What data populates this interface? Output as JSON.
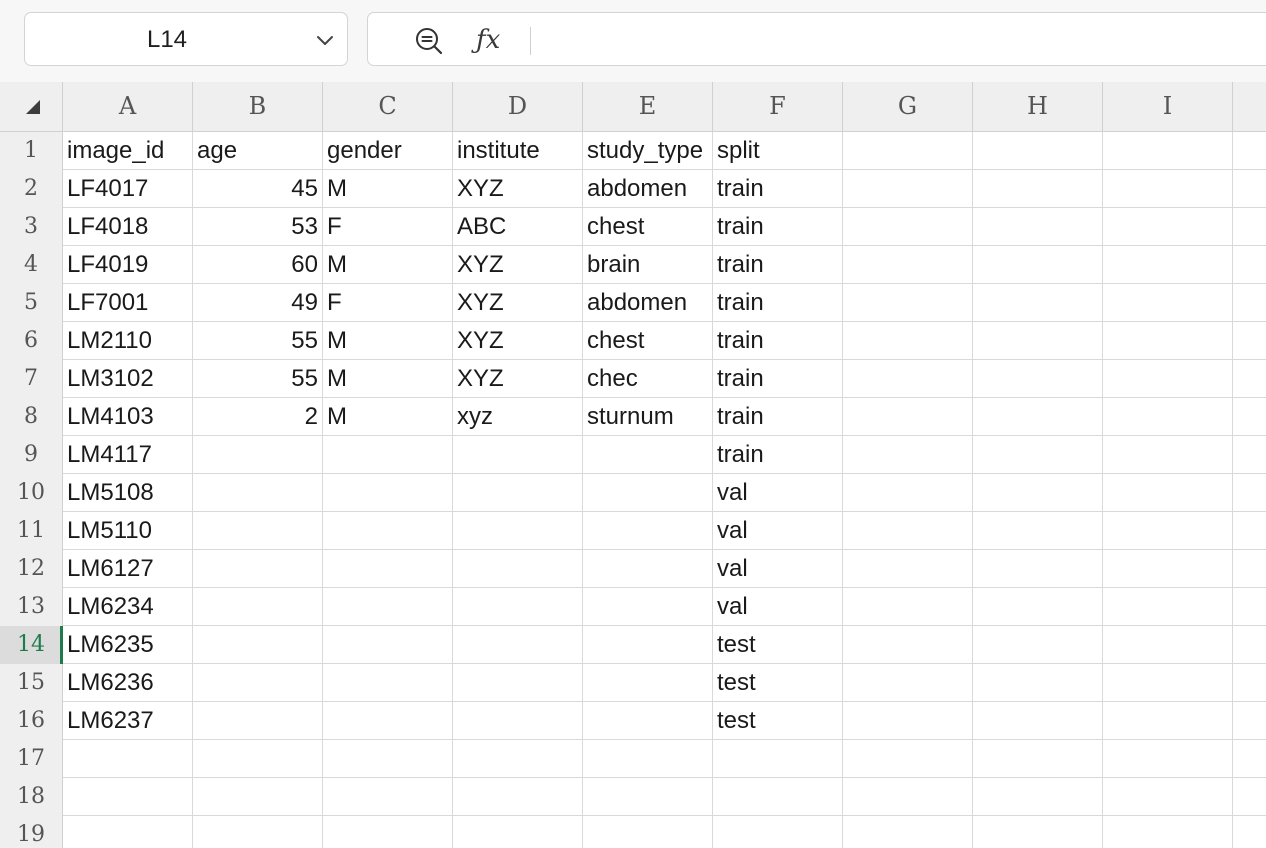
{
  "name_box": {
    "value": "L14"
  },
  "formula_bar": {
    "value": ""
  },
  "sheet": {
    "columns": [
      "A",
      "B",
      "C",
      "D",
      "E",
      "F",
      "G",
      "H",
      "I"
    ],
    "row_numbers": [
      "1",
      "2",
      "3",
      "4",
      "5",
      "6",
      "7",
      "8",
      "9",
      "10",
      "11",
      "12",
      "13",
      "14",
      "15",
      "16",
      "17",
      "18",
      "19"
    ],
    "active_row": "14",
    "rows": [
      [
        "image_id",
        "age",
        "gender",
        "institute",
        "study_type",
        "split"
      ],
      [
        "LF4017",
        "45",
        "M",
        "XYZ",
        "abdomen",
        "train"
      ],
      [
        "LF4018",
        "53",
        "F",
        "ABC",
        "chest",
        "train"
      ],
      [
        "LF4019",
        "60",
        "M",
        "XYZ",
        "brain",
        "train"
      ],
      [
        "LF7001",
        "49",
        "F",
        "XYZ",
        "abdomen",
        "train"
      ],
      [
        "LM2110",
        "55",
        "M",
        "XYZ",
        "chest",
        "train"
      ],
      [
        "LM3102",
        "55",
        "M",
        "XYZ",
        "chec",
        "train"
      ],
      [
        "LM4103",
        "2",
        "M",
        "xyz",
        "sturnum",
        "train"
      ],
      [
        "LM4117",
        "",
        "",
        "",
        "",
        "train"
      ],
      [
        "LM5108",
        "",
        "",
        "",
        "",
        "val"
      ],
      [
        "LM5110",
        "",
        "",
        "",
        "",
        "val"
      ],
      [
        "LM6127",
        "",
        "",
        "",
        "",
        "val"
      ],
      [
        "LM6234",
        "",
        "",
        "",
        "",
        "val"
      ],
      [
        "LM6235",
        "",
        "",
        "",
        "",
        "test"
      ],
      [
        "LM6236",
        "",
        "",
        "",
        "",
        "test"
      ],
      [
        "LM6237",
        "",
        "",
        "",
        "",
        "test"
      ]
    ]
  },
  "icons": {
    "name_box_dropdown": "chevron-down-icon",
    "zoom": "zoom-out-icon",
    "function": "fx-icon",
    "select_all": "select-all-triangle-icon"
  },
  "colors": {
    "active_accent": "#1e7b4c",
    "header_bg": "#efefef",
    "gridline": "#d9d9d9"
  }
}
